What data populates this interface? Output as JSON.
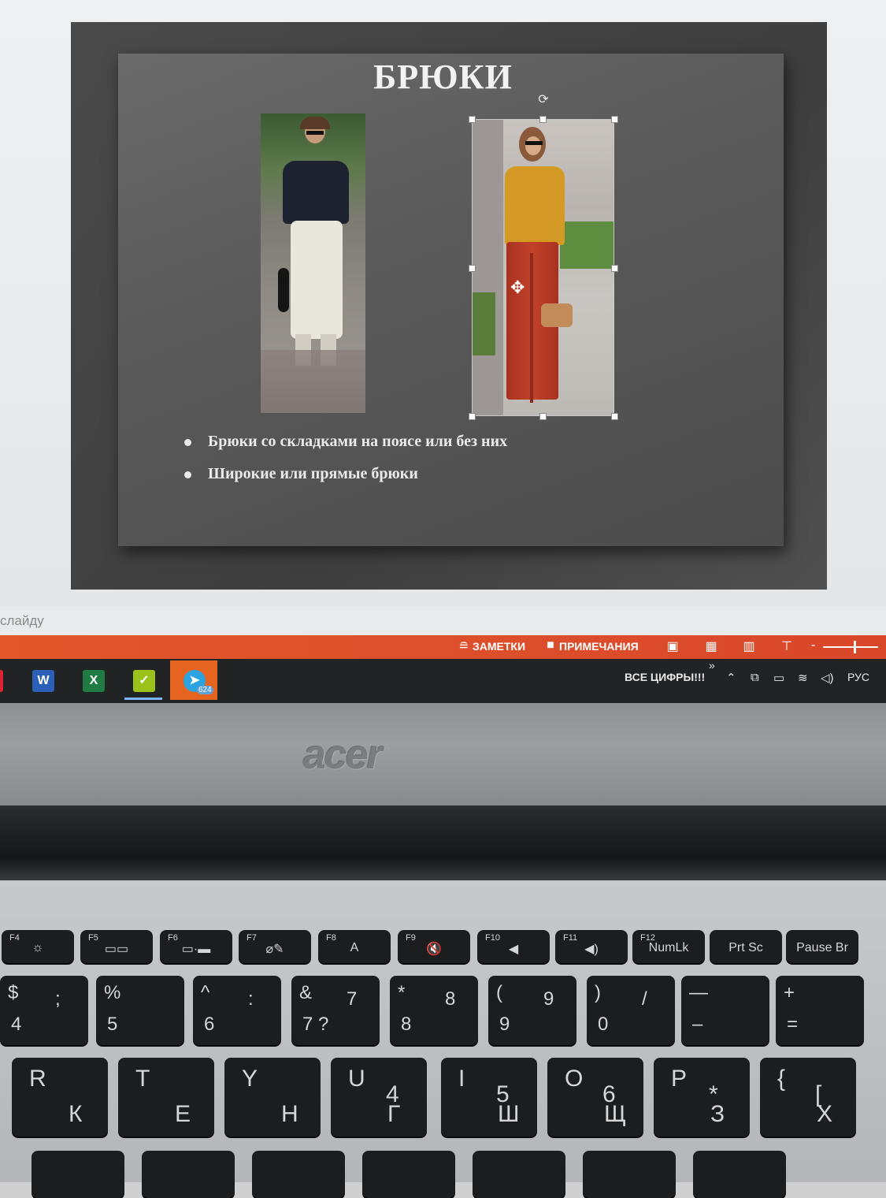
{
  "slide": {
    "title": "БРЮКИ",
    "bullets": [
      "Брюки со складками на поясе или без них",
      "Широкие или прямые брюки"
    ]
  },
  "notes_hint": "слайду",
  "statusbar": {
    "notes_label": "ЗАМЕТКИ",
    "comments_label": "ПРИМЕЧАНИЯ",
    "zoom_minus": "-"
  },
  "taskbar": {
    "apps": [
      "word-icon",
      "excel-icon",
      "tasks-icon",
      "telegram-icon"
    ],
    "word_glyph": "W",
    "excel_glyph": "X",
    "tasks_glyph": "✓",
    "telegram_badge": "624",
    "tray_text": "ВСЕ ЦИФРЫ!!!",
    "tray_chevron": "»",
    "language": "РУС"
  },
  "laptop": {
    "brand": "acer"
  },
  "keyboard": {
    "fkeys": [
      {
        "f": "F4",
        "c": "☼"
      },
      {
        "f": "F5",
        "c": "▭▭"
      },
      {
        "f": "F6",
        "c": "▭·▬"
      },
      {
        "f": "F7",
        "c": "⌀✎"
      },
      {
        "f": "F8",
        "c": "A"
      },
      {
        "f": "F9",
        "c": "🔇"
      },
      {
        "f": "F10",
        "c": "◀"
      },
      {
        "f": "F11",
        "c": "◀)"
      },
      {
        "f": "F12",
        "c": "NumLk"
      },
      {
        "f": "",
        "c": "Prt Sc"
      },
      {
        "f": "",
        "c": "Pause Br"
      }
    ],
    "row1": [
      {
        "a": "$",
        "b": ";",
        "c": "4"
      },
      {
        "a": "%",
        "b": "",
        "c": "5"
      },
      {
        "a": "^",
        "b": ":",
        "c": "6"
      },
      {
        "a": "&",
        "b": "7",
        "c": "7 ?"
      },
      {
        "a": "*",
        "b": "8",
        "c": "8"
      },
      {
        "a": "(",
        "b": "9",
        "c": "9"
      },
      {
        "a": ")",
        "b": "/",
        "c": "0"
      },
      {
        "a": "—",
        "b": "",
        "c": "–"
      },
      {
        "a": "+",
        "b": "",
        "c": "="
      }
    ],
    "row2": [
      {
        "a": "R",
        "b": "",
        "c": "К"
      },
      {
        "a": "T",
        "b": "",
        "c": "Е"
      },
      {
        "a": "Y",
        "b": "",
        "c": "Н"
      },
      {
        "a": "U",
        "b": "4",
        "c": "Г"
      },
      {
        "a": "I",
        "b": "5",
        "c": "Ш"
      },
      {
        "a": "O",
        "b": "6",
        "c": "Щ"
      },
      {
        "a": "P",
        "b": "*",
        "c": "З"
      },
      {
        "a": "{",
        "b": "[",
        "c": "Х"
      }
    ]
  }
}
